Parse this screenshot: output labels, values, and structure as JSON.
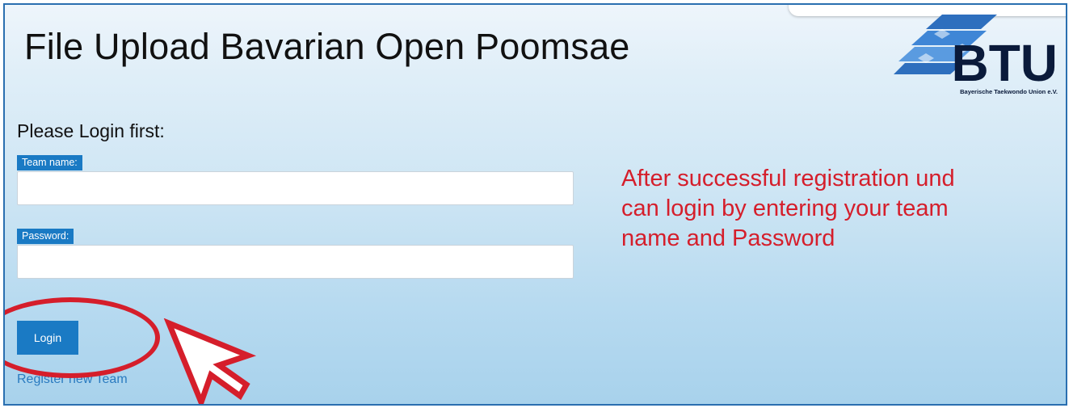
{
  "page": {
    "title": "File Upload Bavarian Open Poomsae"
  },
  "logo": {
    "text": "BTU",
    "subtitle": "Bayerische Taekwondo Union e.V."
  },
  "login_form": {
    "heading": "Please Login first:",
    "team_name": {
      "label": "Team name:",
      "value": "",
      "placeholder": ""
    },
    "password": {
      "label": "Password:",
      "value": "",
      "placeholder": ""
    },
    "submit_label": "Login",
    "register_link": "Register new Team"
  },
  "annotation": {
    "text": "After successful registration und can login by entering your team name and Password"
  },
  "colors": {
    "accent": "#1a7ac4",
    "link": "#2a7bc0",
    "annotation": "#d51e2b",
    "border": "#2a6fb0"
  }
}
